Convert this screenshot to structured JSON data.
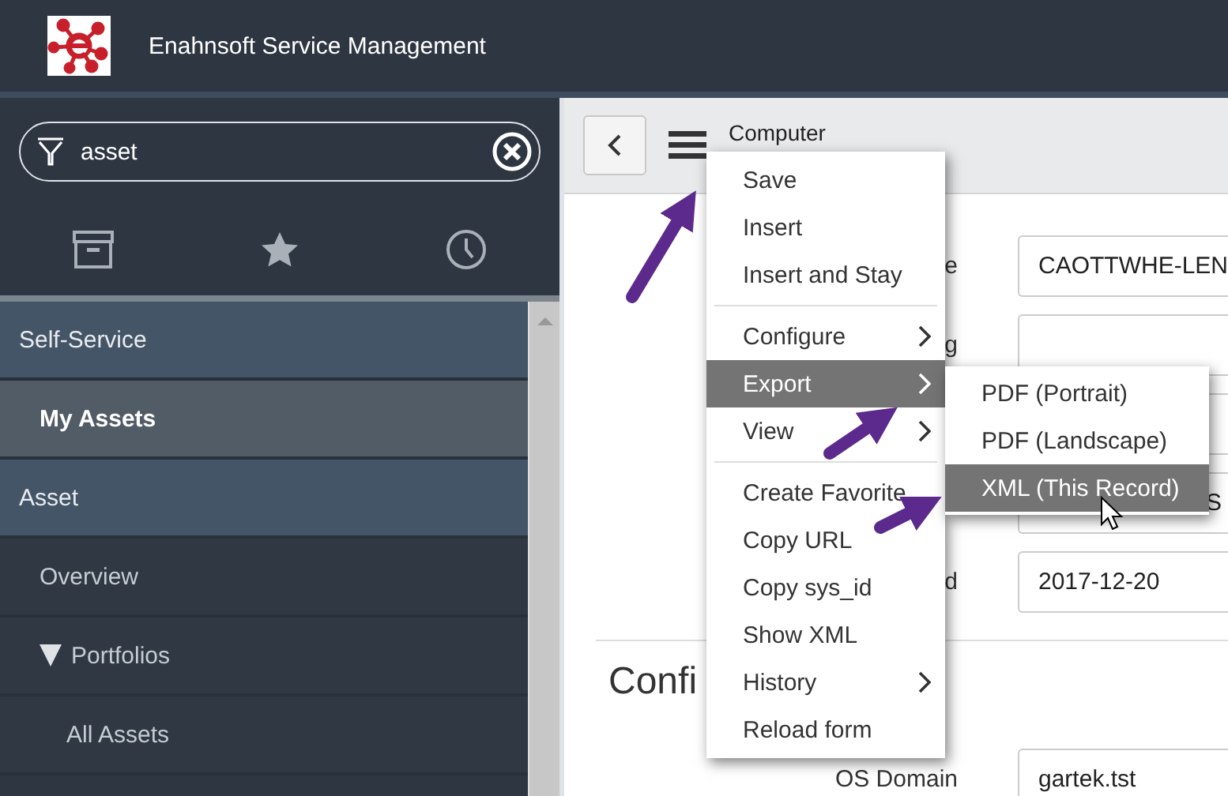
{
  "header": {
    "title": "Enahnsoft Service Management"
  },
  "sidebar": {
    "search": {
      "value": "asset"
    },
    "nav": [
      {
        "label": "Self-Service",
        "selected": false,
        "children": [
          {
            "label": "My Assets",
            "selected": true
          }
        ]
      },
      {
        "label": "Asset",
        "selected": false,
        "children": [
          {
            "label": "Overview",
            "selected": false
          },
          {
            "label": "Portfolios",
            "selected": false,
            "expanded": true,
            "children": [
              {
                "label": "All Assets",
                "selected": false
              }
            ]
          }
        ]
      }
    ]
  },
  "record": {
    "title": "Computer",
    "fields": [
      {
        "kind": "input",
        "label": "e",
        "value": "CAOTTWHE-LEN"
      },
      {
        "kind": "input",
        "label": "g"
      },
      {
        "kind": "input"
      },
      {
        "kind": "clipped",
        "value": "S"
      },
      {
        "kind": "input",
        "label": "d",
        "value": "2017-12-20"
      }
    ],
    "section": {
      "heading": "Confi",
      "fields": [
        {
          "label": "OS Domain",
          "value": "gartek.tst"
        }
      ]
    }
  },
  "context_menu": {
    "groups": [
      [
        {
          "label": "Save",
          "submenu": false,
          "selected": false
        },
        {
          "label": "Insert",
          "submenu": false,
          "selected": false
        },
        {
          "label": "Insert and Stay",
          "submenu": false,
          "selected": false
        }
      ],
      [
        {
          "label": "Configure",
          "submenu": true,
          "selected": false
        },
        {
          "label": "Export",
          "submenu": true,
          "selected": true
        },
        {
          "label": "View",
          "submenu": true,
          "selected": false
        }
      ],
      [
        {
          "label": "Create Favorite",
          "submenu": false,
          "selected": false
        },
        {
          "label": "Copy URL",
          "submenu": false,
          "selected": false
        },
        {
          "label": "Copy sys_id",
          "submenu": false,
          "selected": false
        },
        {
          "label": "Show XML",
          "submenu": false,
          "selected": false
        },
        {
          "label": "History",
          "submenu": true,
          "selected": false
        },
        {
          "label": "Reload form",
          "submenu": false,
          "selected": false
        }
      ]
    ],
    "submenu": [
      {
        "label": "PDF (Portrait)",
        "selected": false
      },
      {
        "label": "PDF (Landscape)",
        "selected": false
      },
      {
        "label": "XML (This Record)",
        "selected": true
      }
    ]
  }
}
